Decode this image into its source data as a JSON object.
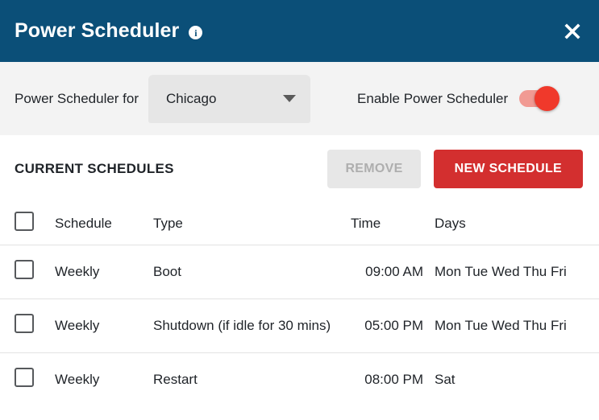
{
  "window": {
    "title": "Power Scheduler",
    "info_icon": "info-icon",
    "info_glyph": "i",
    "close_icon": "close-icon",
    "header_color": "#0b4f78"
  },
  "selector": {
    "label": "Power Scheduler for",
    "dropdown_value": "Chicago",
    "dropdown_icon": "chevron-down-icon",
    "toggle_label": "Enable Power Scheduler",
    "toggle_state": "on",
    "toggle_color": "#f0392b"
  },
  "schedules": {
    "section_title": "CURRENT SCHEDULES",
    "remove_label": "REMOVE",
    "remove_enabled": false,
    "new_schedule_label": "NEW SCHEDULE",
    "new_schedule_color": "#d32f2f",
    "columns": {
      "select": "",
      "schedule": "Schedule",
      "type": "Type",
      "time": "Time",
      "days": "Days"
    },
    "rows": [
      {
        "selected": false,
        "schedule": "Weekly",
        "type": "Boot",
        "time": "09:00 AM",
        "days": "Mon Tue Wed Thu Fri"
      },
      {
        "selected": false,
        "schedule": "Weekly",
        "type": "Shutdown (if idle for 30 mins)",
        "time": "05:00 PM",
        "days": "Mon Tue Wed Thu Fri"
      },
      {
        "selected": false,
        "schedule": "Weekly",
        "type": "Restart",
        "time": "08:00 PM",
        "days": "Sat"
      }
    ]
  }
}
